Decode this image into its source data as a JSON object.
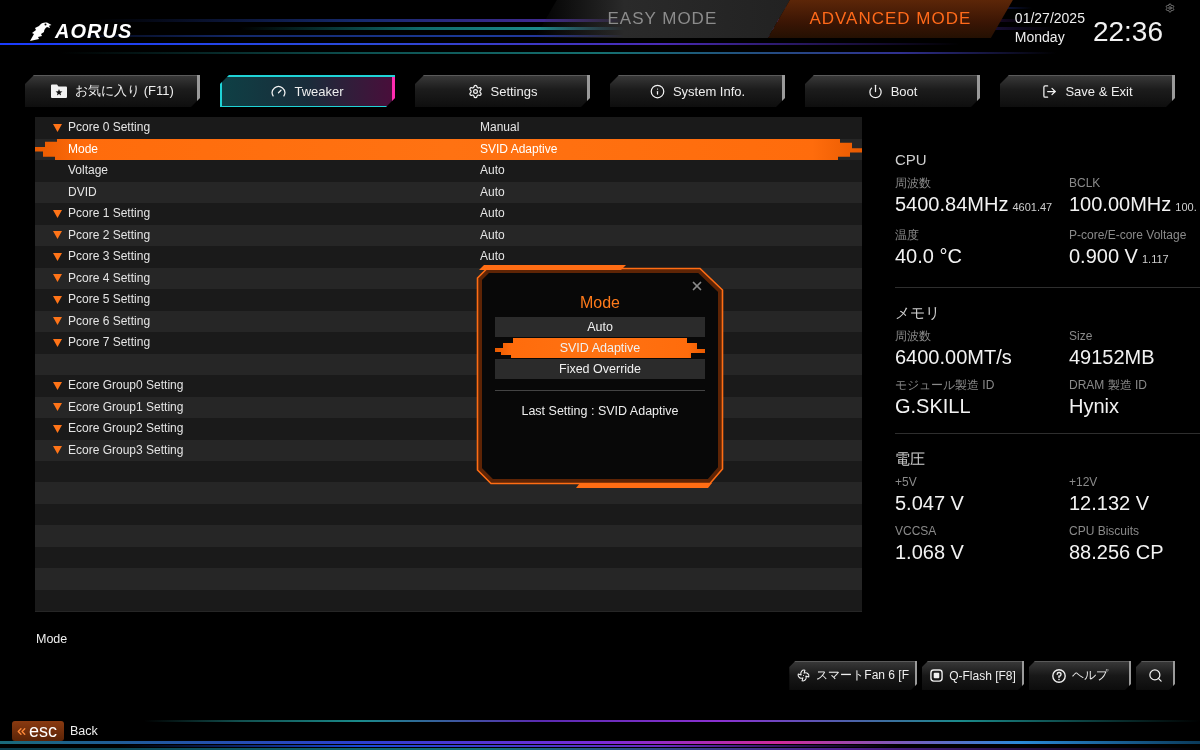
{
  "header": {
    "logo": "AORUS",
    "mode_tabs": [
      {
        "label": "EASY MODE",
        "selected": false
      },
      {
        "label": "ADVANCED MODE",
        "selected": true
      }
    ],
    "date": "01/27/2025",
    "weekday": "Monday",
    "time": "22:36"
  },
  "tabs": [
    {
      "label": "お気に入り (F11)",
      "selected": false
    },
    {
      "label": "Tweaker",
      "selected": true
    },
    {
      "label": "Settings",
      "selected": false
    },
    {
      "label": "System Info.",
      "selected": false
    },
    {
      "label": "Boot",
      "selected": false
    },
    {
      "label": "Save & Exit",
      "selected": false
    }
  ],
  "settings": {
    "rows": [
      {
        "kind": "group",
        "label": "Pcore 0 Setting",
        "value": "Manual",
        "selected": false
      },
      {
        "kind": "item",
        "label": "Mode",
        "value": "SVID Adaptive",
        "selected": true
      },
      {
        "kind": "item",
        "label": "Voltage",
        "value": "Auto",
        "selected": false
      },
      {
        "kind": "item",
        "label": "DVID",
        "value": "Auto",
        "selected": false
      },
      {
        "kind": "group",
        "label": "Pcore 1 Setting",
        "value": "Auto",
        "selected": false
      },
      {
        "kind": "group",
        "label": "Pcore 2 Setting",
        "value": "Auto",
        "selected": false
      },
      {
        "kind": "group",
        "label": "Pcore 3 Setting",
        "value": "Auto",
        "selected": false
      },
      {
        "kind": "group",
        "label": "Pcore 4 Setting",
        "selected": false
      },
      {
        "kind": "group",
        "label": "Pcore 5 Setting",
        "selected": false
      },
      {
        "kind": "group",
        "label": "Pcore 6 Setting",
        "selected": false
      },
      {
        "kind": "group",
        "label": "Pcore 7 Setting",
        "selected": false
      },
      {
        "kind": "spacer"
      },
      {
        "kind": "group",
        "label": "Ecore Group0 Setting",
        "selected": false
      },
      {
        "kind": "group",
        "label": "Ecore Group1 Setting",
        "selected": false
      },
      {
        "kind": "group",
        "label": "Ecore Group2 Setting",
        "selected": false
      },
      {
        "kind": "group",
        "label": "Ecore Group3 Setting",
        "selected": false
      }
    ]
  },
  "dialog": {
    "title": "Mode",
    "options": [
      {
        "label": "Auto",
        "selected": false
      },
      {
        "label": "SVID Adaptive",
        "selected": true
      },
      {
        "label": "Fixed Override",
        "selected": false
      }
    ],
    "note": "Last Setting : SVID Adaptive"
  },
  "monitor": {
    "sections": [
      {
        "title": "CPU",
        "items": [
          {
            "label": "周波数",
            "value": "5400.84MHz",
            "sub": "4601.47"
          },
          {
            "label": "BCLK",
            "value": "100.00MHz",
            "sub": "100."
          },
          {
            "label": "温度",
            "value": "40.0 °C"
          },
          {
            "label": "P-core/E-core Voltage",
            "value": "0.900 V",
            "sub": "1.117"
          }
        ]
      },
      {
        "title": "メモリ",
        "items": [
          {
            "label": "周波数",
            "value": "6400.00MT/s"
          },
          {
            "label": "Size",
            "value": "49152MB"
          },
          {
            "label": "モジュール製造 ID",
            "value": "G.SKILL"
          },
          {
            "label": "DRAM 製造 ID",
            "value": "Hynix"
          }
        ]
      },
      {
        "title": "電圧",
        "items": [
          {
            "label": "+5V",
            "value": "5.047 V"
          },
          {
            "label": "+12V",
            "value": "12.132 V"
          },
          {
            "label": "VCCSA",
            "value": "1.068 V"
          },
          {
            "label": "CPU Biscuits",
            "value": "88.256 CP"
          }
        ]
      }
    ]
  },
  "help_text": "Mode",
  "bottom_buttons": [
    {
      "label": "スマートFan 6 [F"
    },
    {
      "label": "Q-Flash [F8]"
    },
    {
      "label": "ヘルプ"
    }
  ],
  "footer": {
    "key": "esc",
    "label": "Back"
  }
}
